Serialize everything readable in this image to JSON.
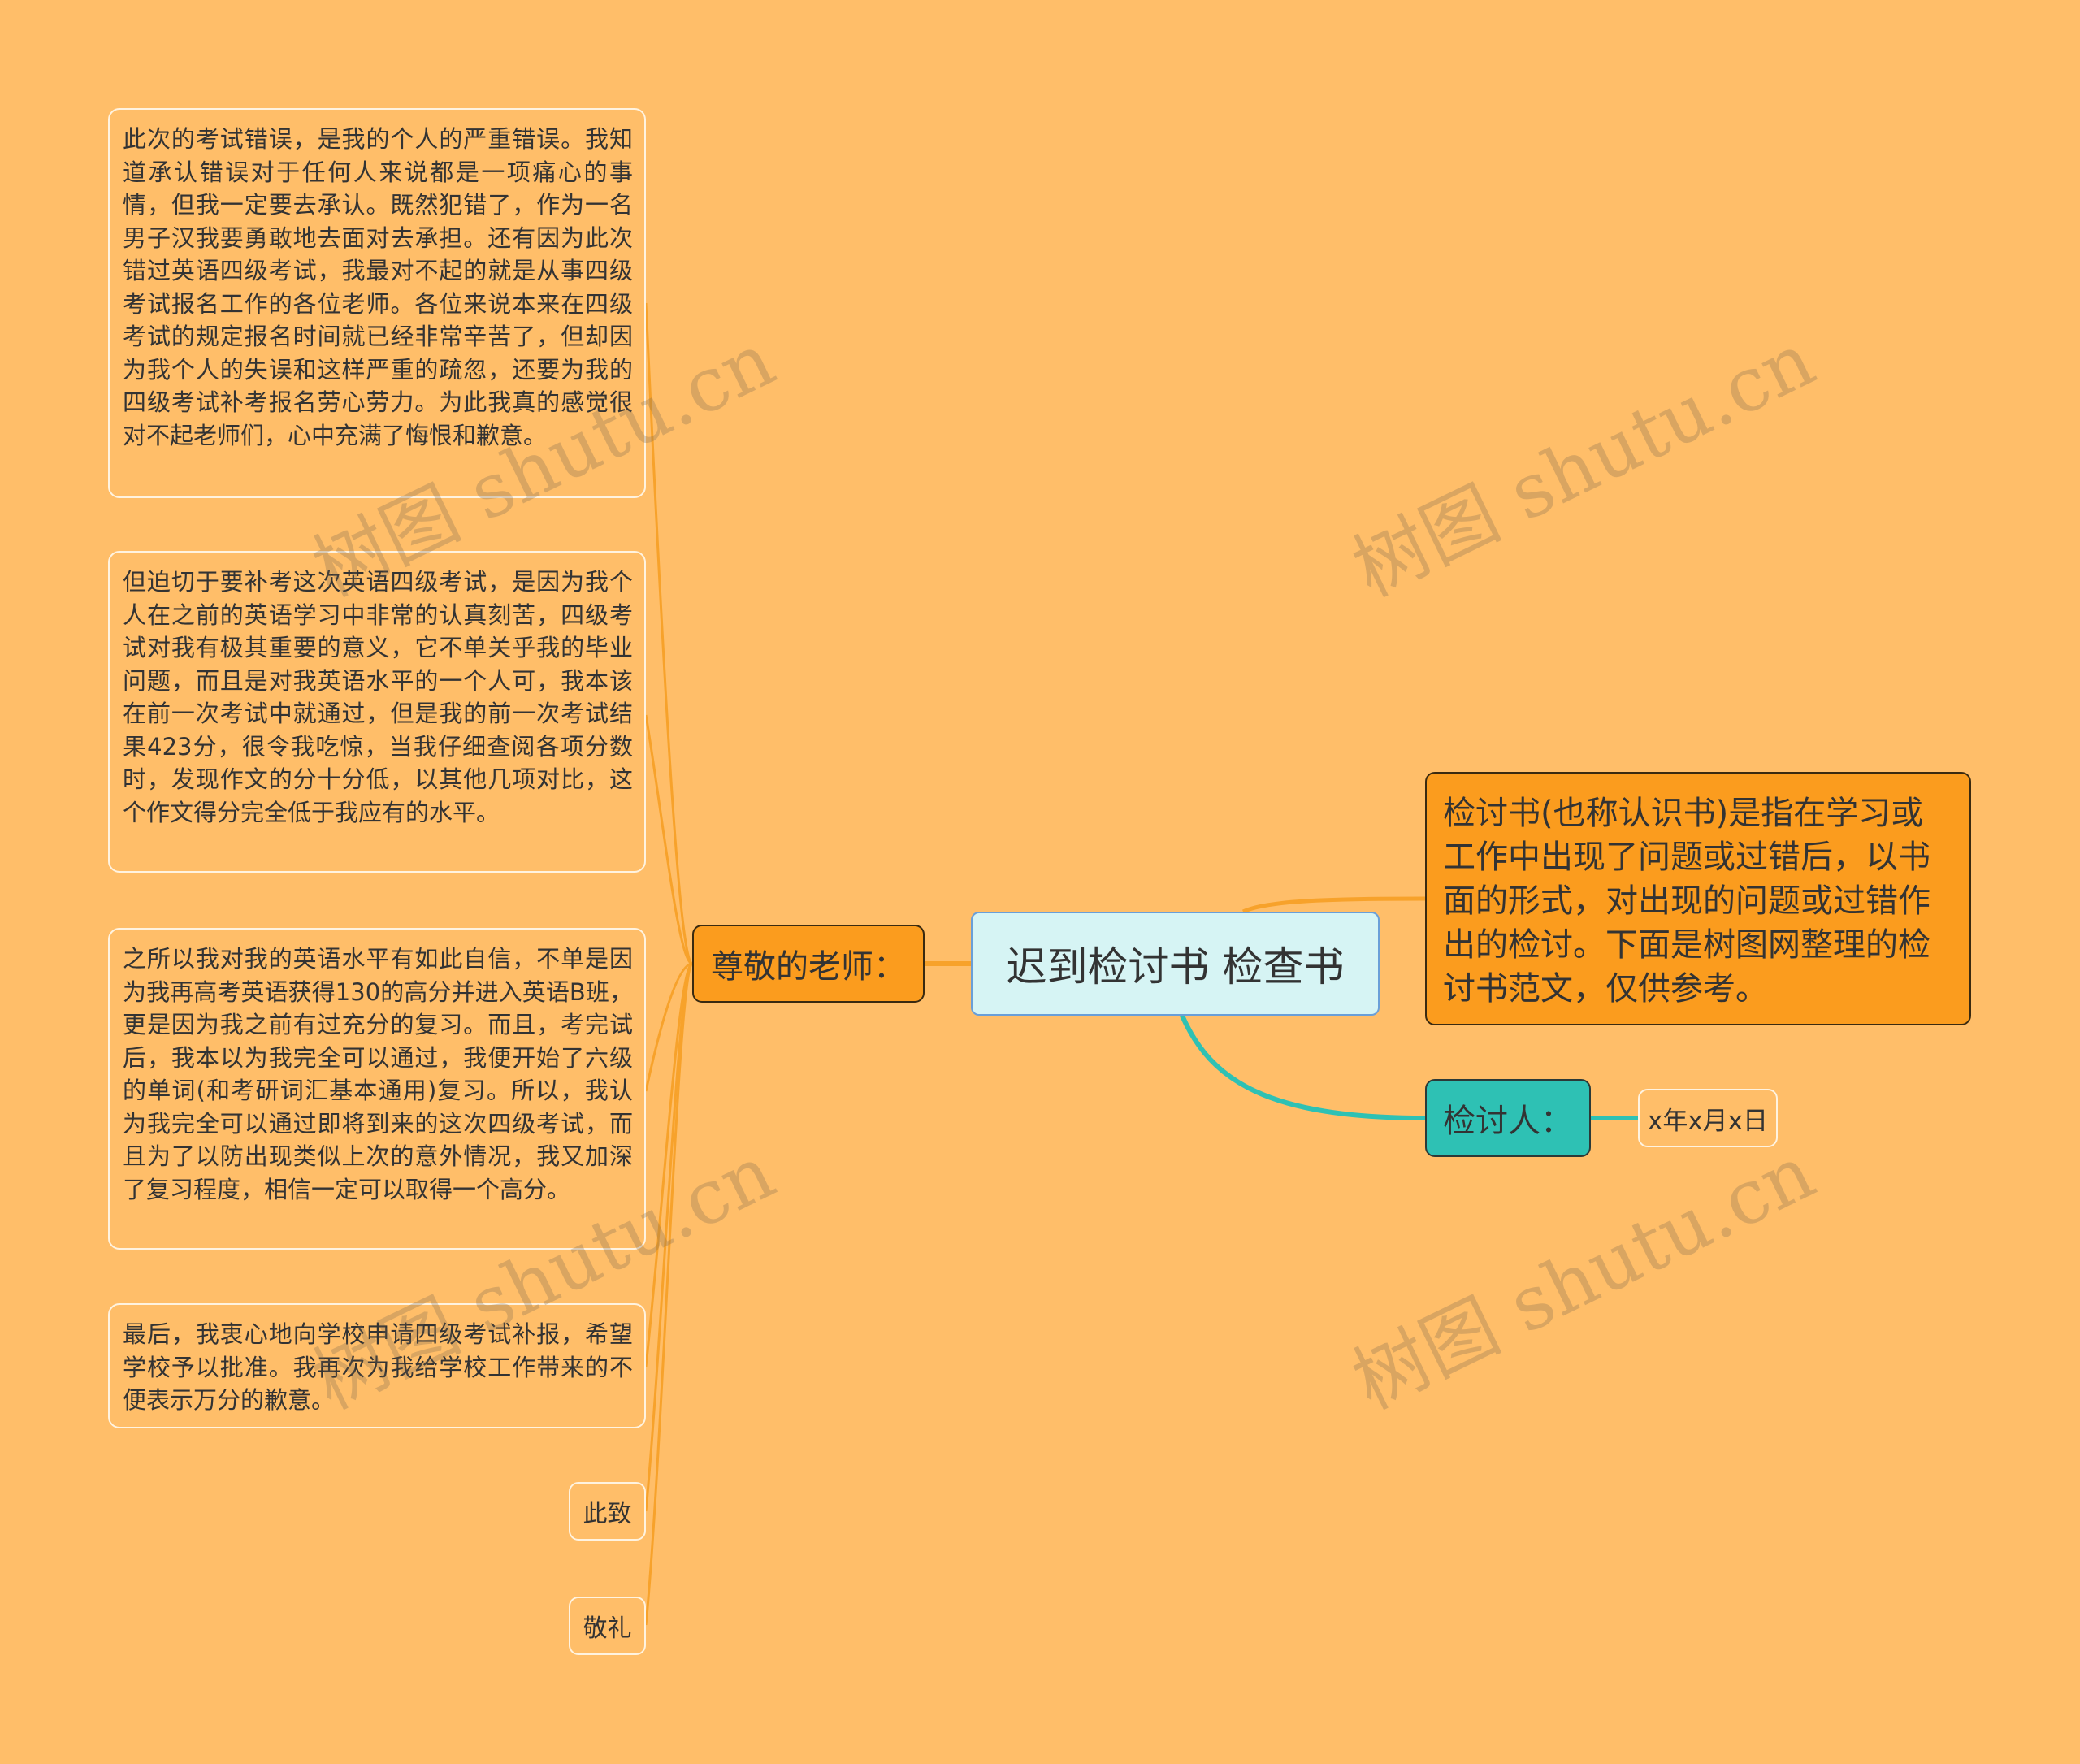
{
  "root": {
    "label": "迟到检讨书 检查书"
  },
  "left_branch": {
    "label": "尊敬的老师：",
    "children": [
      "此次的考试错误，是我的个人的严重错误。我知道承认错误对于任何人来说都是一项痛心的事情，但我一定要去承认。既然犯错了，作为一名男子汉我要勇敢地去面对去承担。还有因为此次错过英语四级考试，我最对不起的就是从事四级考试报名工作的各位老师。各位来说本来在四级考试的规定报名时间就已经非常辛苦了，但却因为我个人的失误和这样严重的疏忽，还要为我的四级考试补考报名劳心劳力。为此我真的感觉很对不起老师们，心中充满了悔恨和歉意。",
      "但迫切于要补考这次英语四级考试，是因为我个人在之前的英语学习中非常的认真刻苦，四级考试对我有极其重要的意义，它不单关乎我的毕业问题，而且是对我英语水平的一个人可，我本该在前一次考试中就通过，但是我的前一次考试结果423分，很令我吃惊，当我仔细查阅各项分数时，发现作文的分十分低，以其他几项对比，这个作文得分完全低于我应有的水平。",
      "之所以我对我的英语水平有如此自信，不单是因为我再高考英语获得130的高分并进入英语B班，更是因为我之前有过充分的复习。而且，考完试后，我本以为我完全可以通过，我便开始了六级的单词(和考研词汇基本通用)复习。所以，我认为我完全可以通过即将到来的这次四级考试，而且为了以防出现类似上次的意外情况，我又加深了复习程度，相信一定可以取得一个高分。",
      "最后，我衷心地向学校申请四级考试补报，希望学校予以批准。我再次为我给学校工作带来的不便表示万分的歉意。",
      "此致",
      "敬礼"
    ]
  },
  "right_desc": {
    "text": "检讨书(也称认识书)是指在学习或工作中出现了问题或过错后，以书面的形式，对出现的问题或过错作出的检讨。下面是树图网整理的检讨书范文，仅供参考。"
  },
  "right_branch": {
    "label": "检讨人：",
    "child": "x年x月x日"
  },
  "watermark": "树图 shutu.cn",
  "colors": {
    "background": "#FFBE69",
    "orange_node": "#FB9C1E",
    "teal_node": "#2EC1B4",
    "root_fill": "#D6F4F4",
    "orange_line": "#F7A22B",
    "teal_line": "#2EC1B4"
  }
}
